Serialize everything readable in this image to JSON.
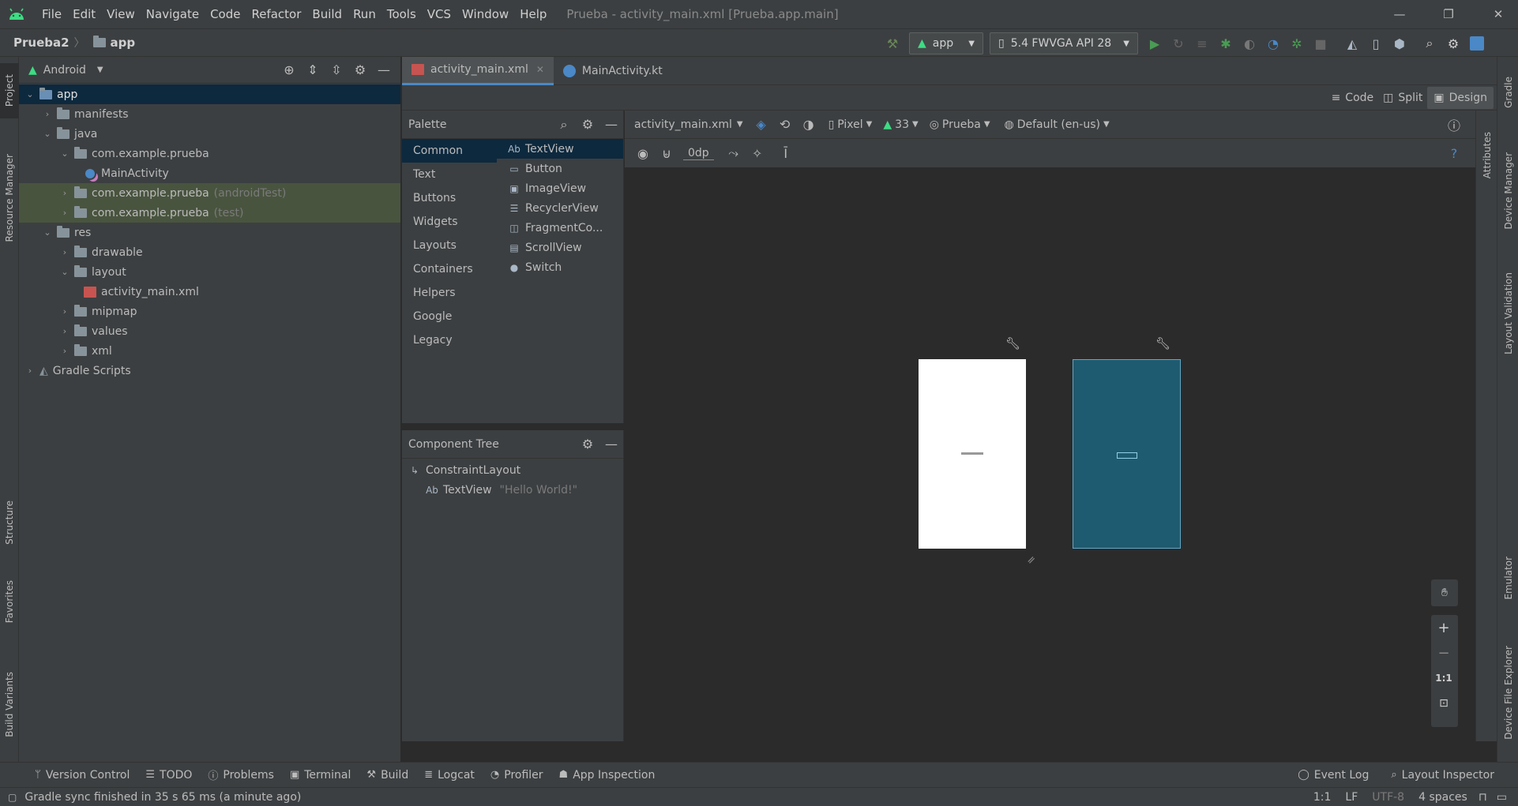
{
  "menubar": {
    "items": [
      "File",
      "Edit",
      "View",
      "Navigate",
      "Code",
      "Refactor",
      "Build",
      "Run",
      "Tools",
      "VCS",
      "Window",
      "Help"
    ],
    "title": "Prueba - activity_main.xml [Prueba.app.main]"
  },
  "navbar": {
    "project": "Prueba2",
    "module": "app",
    "run_config": "app",
    "device": "5.4  FWVGA API 28"
  },
  "left_tabs": [
    "Project",
    "Resource Manager",
    "Structure",
    "Favorites",
    "Build Variants"
  ],
  "right_tabs": [
    "Gradle",
    "Device Manager",
    "Layout Validation",
    "Emulator",
    "Device File Explorer"
  ],
  "attributes_tab": "Attributes",
  "project_panel": {
    "view": "Android",
    "tree": [
      {
        "label": "app",
        "hint": "",
        "depth": 0
      },
      {
        "label": "manifests",
        "hint": "",
        "depth": 1
      },
      {
        "label": "java",
        "hint": "",
        "depth": 1
      },
      {
        "label": "com.example.prueba",
        "hint": "",
        "depth": 2
      },
      {
        "label": "MainActivity",
        "hint": "",
        "depth": 3
      },
      {
        "label": "com.example.prueba",
        "hint": "(androidTest)",
        "depth": 2
      },
      {
        "label": "com.example.prueba",
        "hint": "(test)",
        "depth": 2
      },
      {
        "label": "res",
        "hint": "",
        "depth": 1
      },
      {
        "label": "drawable",
        "hint": "",
        "depth": 2
      },
      {
        "label": "layout",
        "hint": "",
        "depth": 2
      },
      {
        "label": "activity_main.xml",
        "hint": "",
        "depth": 3
      },
      {
        "label": "mipmap",
        "hint": "",
        "depth": 2
      },
      {
        "label": "values",
        "hint": "",
        "depth": 2
      },
      {
        "label": "xml",
        "hint": "",
        "depth": 2
      },
      {
        "label": "Gradle Scripts",
        "hint": "",
        "depth": 0
      }
    ]
  },
  "editor_tabs": [
    {
      "label": "activity_main.xml"
    },
    {
      "label": "MainActivity.kt"
    }
  ],
  "view_modes": {
    "code": "Code",
    "split": "Split",
    "design": "Design"
  },
  "palette": {
    "title": "Palette",
    "categories": [
      "Common",
      "Text",
      "Buttons",
      "Widgets",
      "Layouts",
      "Containers",
      "Helpers",
      "Google",
      "Legacy"
    ],
    "components": [
      {
        "icon": "Ab",
        "label": "TextView"
      },
      {
        "icon": "▭",
        "label": "Button"
      },
      {
        "icon": "▣",
        "label": "ImageView"
      },
      {
        "icon": "☰",
        "label": "RecyclerView"
      },
      {
        "icon": "◫",
        "label": "FragmentCo..."
      },
      {
        "icon": "▤",
        "label": "ScrollView"
      },
      {
        "icon": "●",
        "label": "Switch"
      }
    ]
  },
  "component_tree": {
    "title": "Component Tree",
    "root": "ConstraintLayout",
    "child_icon": "Ab",
    "child": "TextView",
    "child_hint": "\"Hello World!\""
  },
  "design_toolbar": {
    "file": "activity_main.xml",
    "device": "Pixel",
    "api": "33",
    "theme": "Prueba",
    "locale": "Default (en-us)",
    "margin": "0dp"
  },
  "zoom": {
    "plus": "+",
    "minus": "−",
    "one_to_one": "1:1"
  },
  "bottom_tools": [
    "Version Control",
    "TODO",
    "Problems",
    "Terminal",
    "Build",
    "Logcat",
    "Profiler",
    "App Inspection"
  ],
  "bottom_right_tools": [
    "Event Log",
    "Layout Inspector"
  ],
  "status": {
    "message": "Gradle sync finished in 35 s 65 ms (a minute ago)",
    "position": "1:1",
    "line_sep": "LF",
    "encoding": "UTF-8",
    "indent": "4 spaces"
  },
  "colors": {
    "accent": "#4a88c7",
    "android_green": "#3ddc84",
    "run_green": "#499c54",
    "blueprint": "#1f5b70"
  }
}
